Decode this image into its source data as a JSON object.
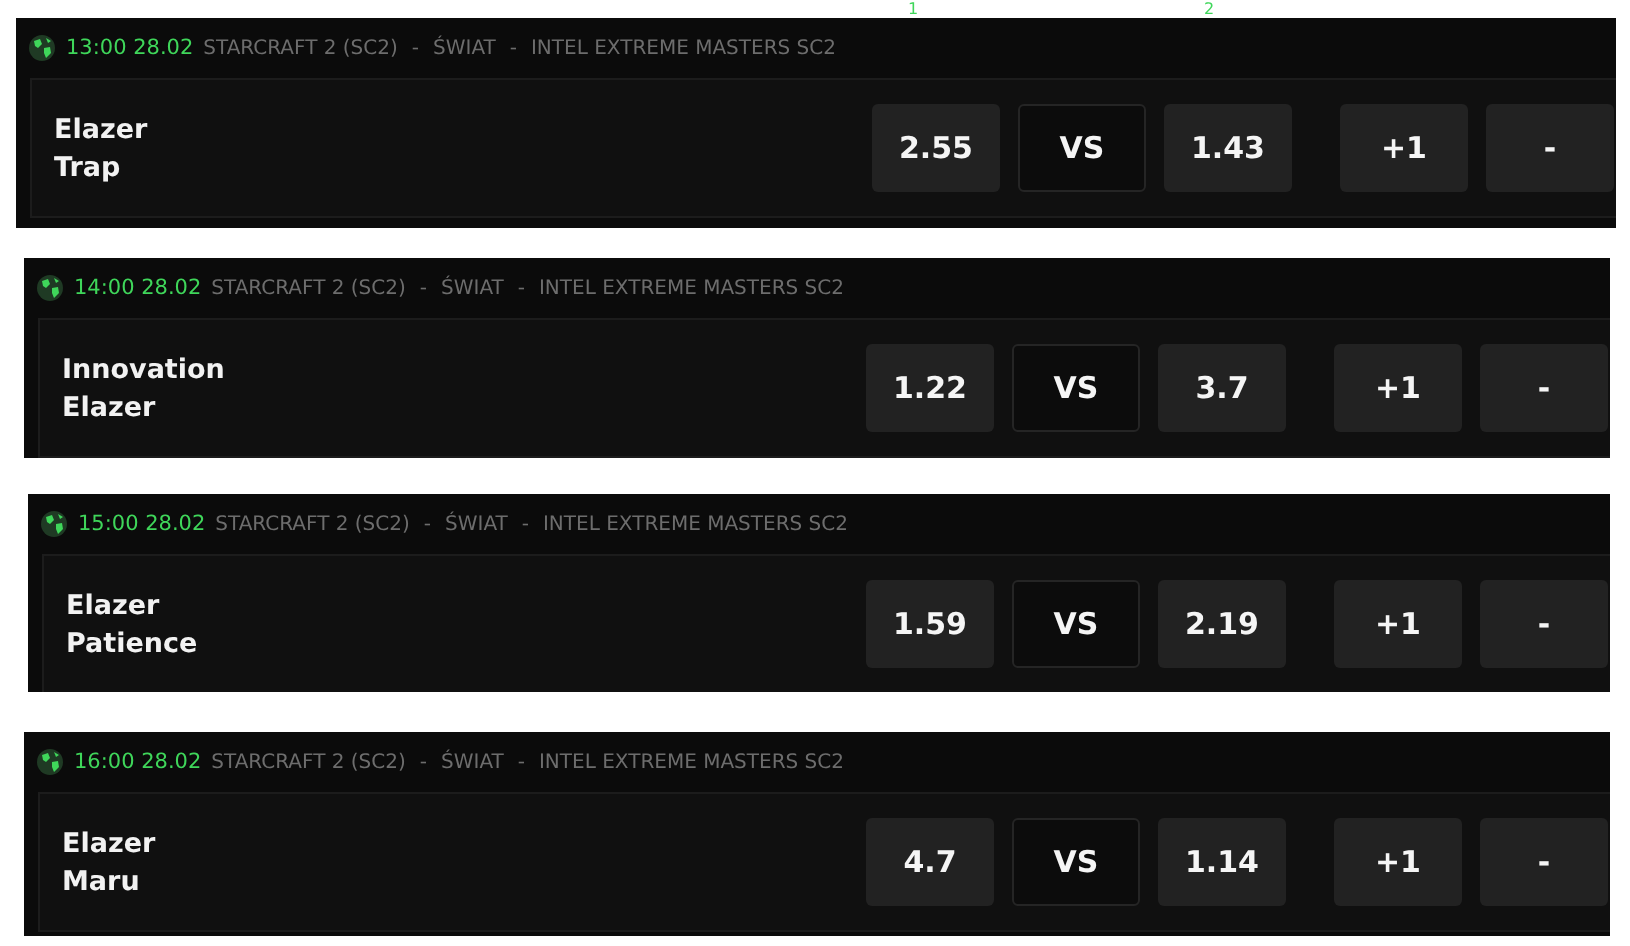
{
  "columns": [
    "1",
    "2"
  ],
  "matches": [
    {
      "time": "13:00 28.02",
      "category": "STARCRAFT 2 (SC2)",
      "separators": [
        "-",
        "-"
      ],
      "region": "ŚWIAT",
      "league": "INTEL EXTREME MASTERS SC2",
      "players": [
        "Elazer",
        "Trap"
      ],
      "odds_1": "2.55",
      "vs": "VS",
      "odds_2": "1.43",
      "more": "+1",
      "extra": "-"
    },
    {
      "time": "14:00 28.02",
      "category": "STARCRAFT 2 (SC2)",
      "separators": [
        "-",
        "-"
      ],
      "region": "ŚWIAT",
      "league": "INTEL EXTREME MASTERS SC2",
      "players": [
        "Innovation",
        "Elazer"
      ],
      "odds_1": "1.22",
      "vs": "VS",
      "odds_2": "3.7",
      "more": "+1",
      "extra": "-"
    },
    {
      "time": "15:00 28.02",
      "category": "STARCRAFT 2 (SC2)",
      "separators": [
        "-",
        "-"
      ],
      "region": "ŚWIAT",
      "league": "INTEL EXTREME MASTERS SC2",
      "players": [
        "Elazer",
        "Patience"
      ],
      "odds_1": "1.59",
      "vs": "VS",
      "odds_2": "2.19",
      "more": "+1",
      "extra": "-"
    },
    {
      "time": "16:00 28.02",
      "category": "STARCRAFT 2 (SC2)",
      "separators": [
        "-",
        "-"
      ],
      "region": "ŚWIAT",
      "league": "INTEL EXTREME MASTERS SC2",
      "players": [
        "Elazer",
        "Maru"
      ],
      "odds_1": "4.7",
      "vs": "VS",
      "odds_2": "1.14",
      "more": "+1",
      "extra": "-"
    }
  ]
}
